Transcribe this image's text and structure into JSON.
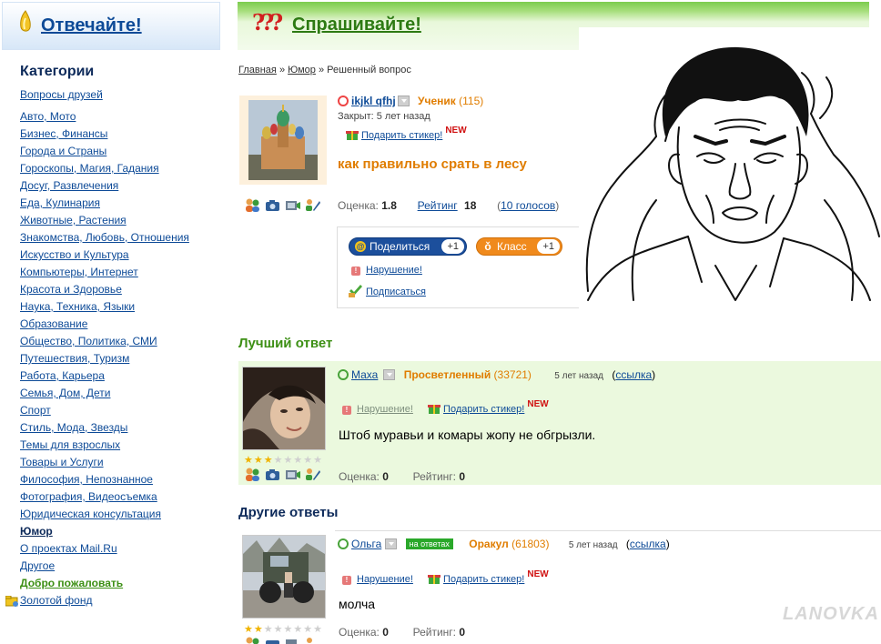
{
  "left": {
    "header_title": "Отвечайте!",
    "categories_title": "Категории",
    "friends_link": "Вопросы друзей",
    "categories": [
      "Авто, Мото",
      "Бизнес, Финансы",
      "Города и Страны",
      "Гороскопы, Магия, Гадания",
      "Досуг, Развлечения",
      "Еда, Кулинария",
      "Животные, Растения",
      "Знакомства, Любовь, Отношения",
      "Искусство и Культура",
      "Компьютеры, Интернет",
      "Красота и Здоровье",
      "Наука, Техника, Языки",
      "Образование",
      "Общество, Политика, СМИ",
      "Путешествия, Туризм",
      "Работа, Карьера",
      "Семья, Дом, Дети",
      "Спорт",
      "Стиль, Мода, Звезды",
      "Темы для взрослых",
      "Товары и Услуги",
      "Философия, Непознанное",
      "Фотография, Видеосъемка",
      "Юридическая консультация",
      "Юмор",
      "О проектах Mail.Ru",
      "Другое",
      "Добро пожаловать",
      "Золотой фонд"
    ]
  },
  "ask": {
    "header_title": "Спрашивайте!"
  },
  "breadcrumb": {
    "home": "Главная",
    "sep": "»",
    "section": "Юмор",
    "current": "Решенный вопрос"
  },
  "question": {
    "user": "ikjkl qfhj",
    "rank": "Ученик",
    "rank_points": "(115)",
    "closed": "Закрыт: 5 лет назад",
    "gift": "Подарить стикер!",
    "new": "NEW",
    "title": "как правильно срать в лесу",
    "score_label": "Оценка:",
    "score": "1.8",
    "rating_label": "Рейтинг",
    "rating": "18",
    "votes": "10 голосов",
    "share_label": "Поделиться",
    "share_count": "+1",
    "class_label": "Класс",
    "class_count": "+1",
    "violation": "Нарушение!",
    "subscribe": "Подписаться"
  },
  "best": {
    "title": "Лучший ответ",
    "user": "Маха",
    "rank": "Просветленный",
    "rank_points": "(33721)",
    "time": "5 лет назад",
    "link": "ссылка",
    "violation": "Нарушение!",
    "gift": "Подарить стикер!",
    "new": "NEW",
    "text": "Штоб муравьи и комары жопу не обгрызли.",
    "score_label": "Оценка:",
    "score": "0",
    "rating_label": "Рейтинг:",
    "rating": "0",
    "stars_on": 3
  },
  "other": {
    "title": "Другие ответы",
    "answers": [
      {
        "user": "Ольга",
        "badge": "на ответах",
        "rank": "Оракул",
        "rank_points": "(61803)",
        "time": "5 лет назад",
        "link": "ссылка",
        "violation": "Нарушение!",
        "gift": "Подарить стикер!",
        "new": "NEW",
        "text": "молча",
        "score_label": "Оценка:",
        "score": "0",
        "rating_label": "Рейтинг:",
        "rating": "0",
        "stars_on": 2
      }
    ]
  },
  "watermark": "LANOVKA",
  "colors": {
    "link": "#0d4a97",
    "green_title": "#3c8f14",
    "orange_rank": "#e07d00",
    "best_bg": "#ebf9de"
  }
}
